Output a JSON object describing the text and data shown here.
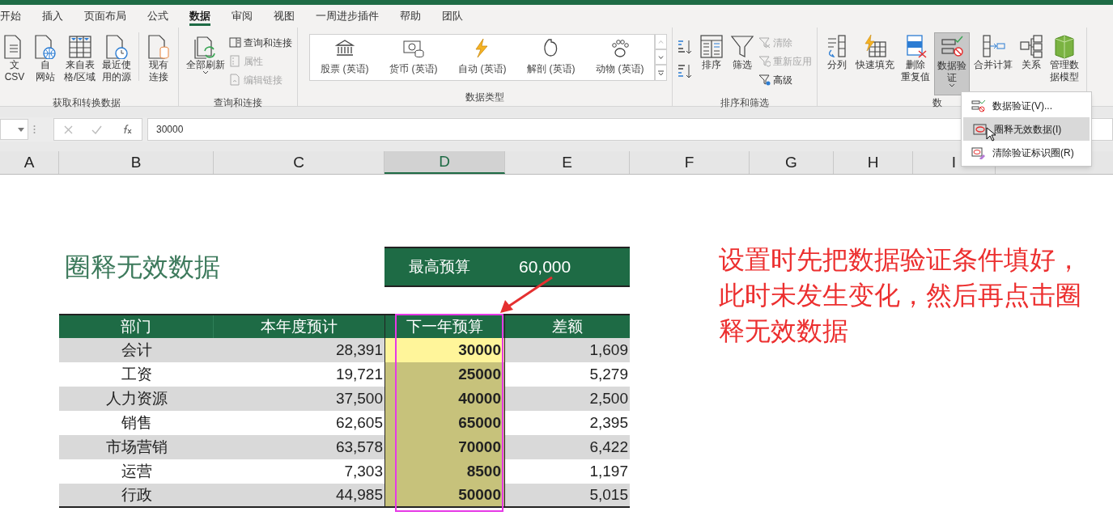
{
  "tabs": [
    {
      "label": "开始",
      "selected": false
    },
    {
      "label": "插入",
      "selected": false
    },
    {
      "label": "页面布局",
      "selected": false
    },
    {
      "label": "公式",
      "selected": false
    },
    {
      "label": "数据",
      "selected": true
    },
    {
      "label": "审阅",
      "selected": false
    },
    {
      "label": "视图",
      "selected": false
    },
    {
      "label": "一周进步插件",
      "selected": false
    },
    {
      "label": "帮助",
      "selected": false
    },
    {
      "label": "团队",
      "selected": false
    }
  ],
  "ribbon_groups": [
    {
      "label": "获取和转换数据",
      "items": [
        {
          "kind": "large",
          "lines": [
            "文",
            "CSV"
          ]
        },
        {
          "kind": "large",
          "lines": [
            "自",
            "网站"
          ]
        },
        {
          "kind": "large",
          "lines": [
            "来自表",
            "格/区域"
          ]
        },
        {
          "kind": "large",
          "lines": [
            "最近使",
            "用的源"
          ]
        },
        {
          "kind": "large",
          "lines": [
            "现有",
            "连接"
          ]
        }
      ]
    },
    {
      "label": "查询和连接",
      "items": [
        {
          "kind": "large",
          "lines": [
            "全部刷新"
          ],
          "dropdown": true
        },
        {
          "kind": "stack",
          "entries": [
            {
              "label": "查询和连接",
              "disabled": false
            },
            {
              "label": "属性",
              "disabled": true
            },
            {
              "label": "编辑链接",
              "disabled": true
            }
          ]
        }
      ]
    },
    {
      "label": "数据类型",
      "items": [
        {
          "kind": "gallery",
          "entries": [
            "股票 (英语)",
            "货币 (英语)",
            "自动 (英语)",
            "解剖 (英语)",
            "动物 (英语)"
          ]
        }
      ]
    },
    {
      "label": "排序和筛选",
      "items": [
        {
          "kind": "sort"
        },
        {
          "kind": "large",
          "lines": [
            "排序"
          ]
        },
        {
          "kind": "large",
          "lines": [
            "筛选"
          ]
        },
        {
          "kind": "stack",
          "entries": [
            {
              "label": "清除",
              "disabled": true
            },
            {
              "label": "重新应用",
              "disabled": true
            },
            {
              "label": "高级",
              "disabled": false
            }
          ]
        }
      ]
    },
    {
      "label": "数",
      "items": [
        {
          "kind": "large",
          "lines": [
            "分列"
          ]
        },
        {
          "kind": "large",
          "lines": [
            "快速填充"
          ]
        },
        {
          "kind": "large",
          "lines": [
            "删除",
            "重复值"
          ]
        },
        {
          "kind": "large",
          "lines": [
            "数据验",
            "证"
          ],
          "dropdown": true,
          "pressed": true
        },
        {
          "kind": "large",
          "lines": [
            "合并计算"
          ]
        },
        {
          "kind": "large",
          "lines": [
            "关系"
          ]
        },
        {
          "kind": "large",
          "lines": [
            "管理数",
            "据模型"
          ]
        }
      ]
    }
  ],
  "menu": [
    {
      "label": "数据验证(V)...",
      "selected": false
    },
    {
      "label": "圈释无效数据(I)",
      "selected": true
    },
    {
      "label": "清除验证标识圈(R)",
      "selected": false
    }
  ],
  "formula_bar": {
    "value": "30000"
  },
  "columns": [
    {
      "label": "A",
      "selected": false
    },
    {
      "label": "B",
      "selected": false
    },
    {
      "label": "C",
      "selected": false
    },
    {
      "label": "D",
      "selected": true
    },
    {
      "label": "E",
      "selected": false
    },
    {
      "label": "F",
      "selected": false
    },
    {
      "label": "G",
      "selected": false
    },
    {
      "label": "H",
      "selected": false
    },
    {
      "label": "I",
      "selected": false
    }
  ],
  "sheet": {
    "title": "圈释无效数据",
    "max_budget": {
      "label": "最高预算",
      "value": "60,000"
    },
    "table": {
      "columns": [
        "部门",
        "本年度预计",
        "下一年预算",
        "差额"
      ],
      "rows": [
        {
          "cells": [
            "会计",
            "28,391",
            "30000",
            "1,609"
          ],
          "selected": true
        },
        {
          "cells": [
            "工资",
            "19,721",
            "25000",
            "5,279"
          ],
          "selected": false
        },
        {
          "cells": [
            "人力资源",
            "37,500",
            "40000",
            "2,500"
          ],
          "selected": false
        },
        {
          "cells": [
            "销售",
            "62,605",
            "65000",
            "2,395"
          ],
          "selected": false
        },
        {
          "cells": [
            "市场营销",
            "63,578",
            "70000",
            "6,422"
          ],
          "selected": false
        },
        {
          "cells": [
            "运营",
            "7,303",
            "8500",
            "1,197"
          ],
          "selected": false
        },
        {
          "cells": [
            "行政",
            "44,985",
            "50000",
            "5,015"
          ],
          "selected": false
        }
      ]
    }
  },
  "annotation": "设置时先把数据验证条件填好，此时未发生变化，然后再点击圈释无效数据"
}
